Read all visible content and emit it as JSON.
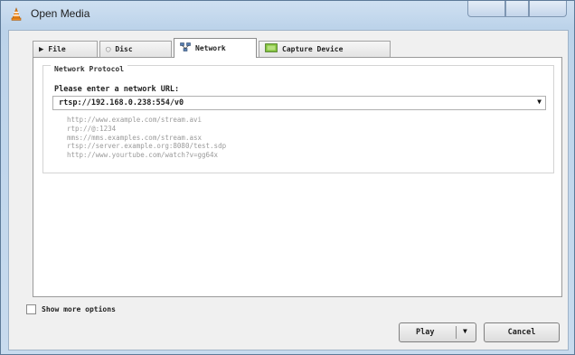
{
  "window": {
    "title": "Open Media",
    "icon": "vlc-cone-icon"
  },
  "tabs": [
    {
      "label": "File",
      "icon": "file-icon",
      "active": false
    },
    {
      "label": "Disc",
      "icon": "disc-icon",
      "active": false
    },
    {
      "label": "Network",
      "icon": "network-icon",
      "active": true
    },
    {
      "label": "Capture Device",
      "icon": "capture-device-icon",
      "active": false
    }
  ],
  "network": {
    "group_title": "Network Protocol",
    "url_label": "Please enter a network URL:",
    "url_value": "rtsp://192.168.0.238:554/v0",
    "examples": [
      "http://www.example.com/stream.avi",
      "rtp://@:1234",
      "mms://mms.examples.com/stream.asx",
      "rtsp://server.example.org:8080/test.sdp",
      "http://www.yourtube.com/watch?v=gg64x"
    ]
  },
  "options": {
    "show_more_label": "Show more options",
    "show_more_checked": false
  },
  "buttons": {
    "play": "Play",
    "cancel": "Cancel"
  },
  "colors": {
    "titlebar": "#c8dbee",
    "client": "#f0f0f0",
    "example_text": "#9a9a9a"
  }
}
